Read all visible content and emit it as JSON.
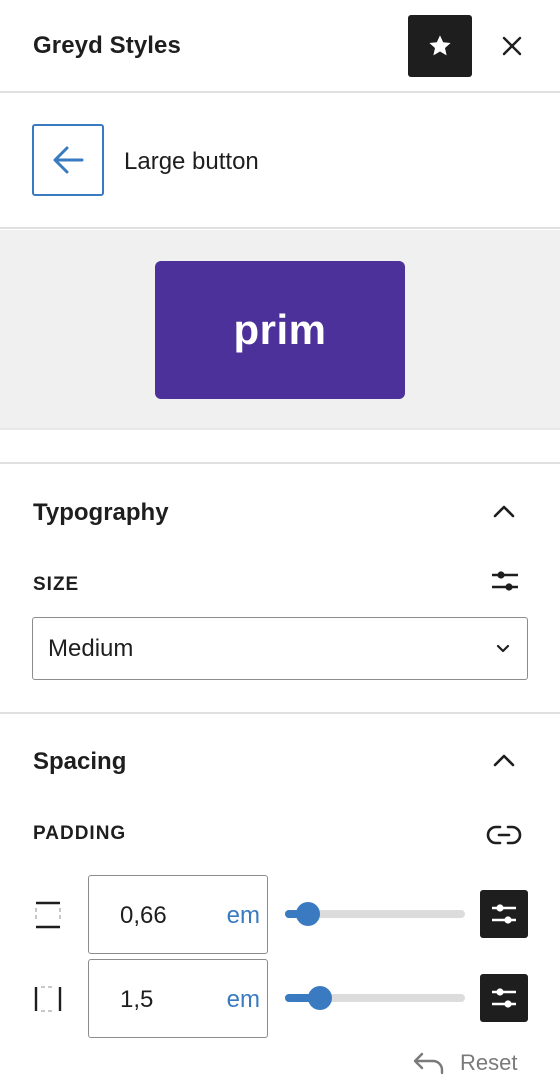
{
  "header": {
    "title": "Greyd Styles"
  },
  "nav": {
    "title": "Large button"
  },
  "preview": {
    "button_label": "prim"
  },
  "typography": {
    "title": "Typography",
    "size_label": "SIZE",
    "size_value": "Medium"
  },
  "spacing": {
    "title": "Spacing",
    "padding_label": "PADDING",
    "rows": [
      {
        "value": "0,66",
        "unit": "em",
        "slider_fraction": 0.07
      },
      {
        "value": "1,5",
        "unit": "em",
        "slider_fraction": 0.15
      }
    ],
    "reset_label": "Reset"
  },
  "colors": {
    "accent": "#3a7ac0",
    "preview_button": "#4b3199",
    "dark": "#1e1e1e"
  }
}
